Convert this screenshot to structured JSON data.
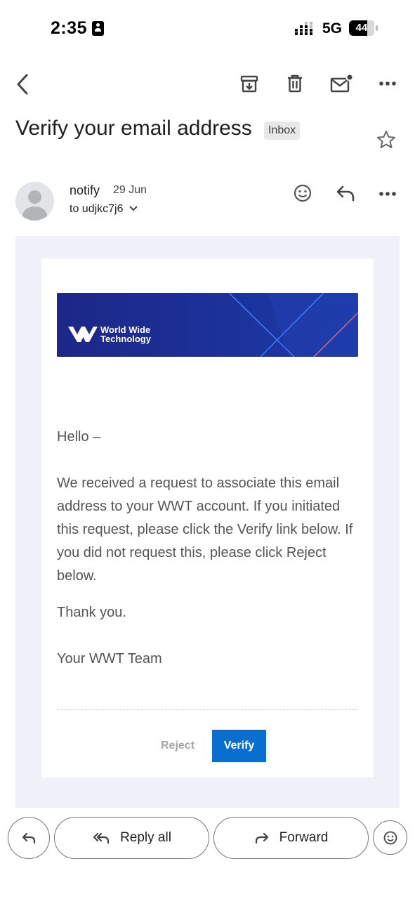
{
  "status_bar": {
    "time": "2:35",
    "network": "5G",
    "battery": "44"
  },
  "toolbar": {
    "back_icon": "back-arrow-icon",
    "archive_icon": "archive-icon",
    "delete_icon": "trash-icon",
    "mark_unread_icon": "mail-unread-icon",
    "more_icon": "more-dots-icon"
  },
  "message": {
    "subject": "Verify your email address",
    "label": "Inbox",
    "sender": "notify",
    "date": "29 Jun",
    "recipient": "to udjkc7j6"
  },
  "email_body": {
    "brand_line1": "World Wide",
    "brand_line2": "Technology",
    "greeting": "Hello –",
    "paragraph": "We received a request to associate this email address to your WWT account. If you initiated this request, please click the Verify link below. If you did not request this, please click Reject below.",
    "thanks": "Thank you.",
    "signature": "Your WWT Team",
    "reject_label": "Reject",
    "verify_label": "Verify",
    "verify_color": "#0a6ed1",
    "banner_color": "#1d2a8f"
  },
  "actions": {
    "reply_all": "Reply all",
    "forward": "Forward"
  }
}
